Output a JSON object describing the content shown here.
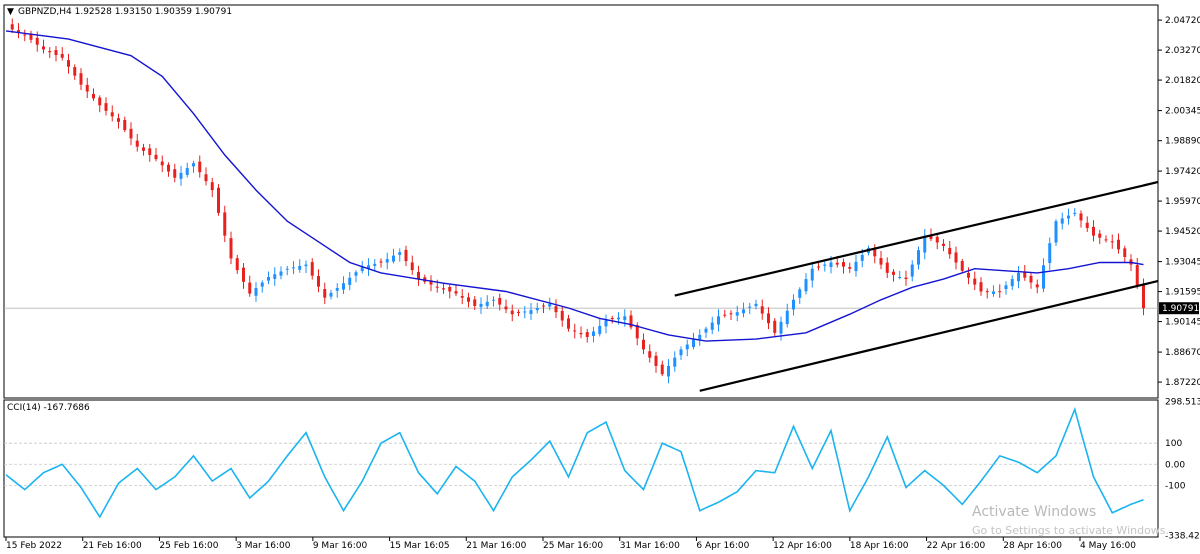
{
  "chart_data": [
    {
      "type": "candlestick",
      "title": "GBPNZD,H4",
      "ohlc_header": "1.92528 1.93150 1.90359 1.90791",
      "current_price": "1.90791",
      "ylim": [
        1.8645,
        2.0545
      ],
      "y_ticks": [
        "2.04720",
        "2.03270",
        "2.01820",
        "2.00345",
        "1.98890",
        "1.97420",
        "1.95970",
        "1.94520",
        "1.93045",
        "1.91595",
        "1.90145",
        "1.88670",
        "1.87220"
      ],
      "x_ticks": [
        "15 Feb 2022",
        "21 Feb 16:00",
        "25 Feb 16:00",
        "3 Mar 16:00",
        "9 Mar 16:00",
        "15 Mar 16:05",
        "21 Mar 16:00",
        "25 Mar 16:00",
        "31 Mar 16:00",
        "6 Apr 16:00",
        "12 Apr 16:00",
        "18 Apr 16:00",
        "22 Apr 16:00",
        "28 Apr 16:00",
        "4 May 16:00"
      ],
      "close_path": [
        [
          0,
          2.044
        ],
        [
          3,
          2.04
        ],
        [
          6,
          2.033
        ],
        [
          9,
          2.029
        ],
        [
          12,
          2.016
        ],
        [
          15,
          2.006
        ],
        [
          18,
          1.998
        ],
        [
          21,
          1.986
        ],
        [
          24,
          1.98
        ],
        [
          27,
          1.971
        ],
        [
          30,
          1.978
        ],
        [
          33,
          1.965
        ],
        [
          36,
          1.932
        ],
        [
          39,
          1.915
        ],
        [
          42,
          1.923
        ],
        [
          45,
          1.927
        ],
        [
          48,
          1.929
        ],
        [
          51,
          1.913
        ],
        [
          54,
          1.92
        ],
        [
          57,
          1.928
        ],
        [
          60,
          1.93
        ],
        [
          63,
          1.935
        ],
        [
          66,
          1.922
        ],
        [
          69,
          1.918
        ],
        [
          72,
          1.915
        ],
        [
          75,
          1.909
        ],
        [
          78,
          1.912
        ],
        [
          81,
          1.905
        ],
        [
          84,
          1.907
        ],
        [
          87,
          1.91
        ],
        [
          90,
          1.898
        ],
        [
          93,
          1.894
        ],
        [
          96,
          1.902
        ],
        [
          99,
          1.904
        ],
        [
          102,
          1.888
        ],
        [
          105,
          1.876
        ],
        [
          108,
          1.888
        ],
        [
          111,
          1.895
        ],
        [
          114,
          1.904
        ],
        [
          117,
          1.906
        ],
        [
          120,
          1.91
        ],
        [
          123,
          1.896
        ],
        [
          126,
          1.912
        ],
        [
          129,
          1.927
        ],
        [
          132,
          1.93
        ],
        [
          135,
          1.927
        ],
        [
          138,
          1.937
        ],
        [
          141,
          1.925
        ],
        [
          144,
          1.922
        ],
        [
          147,
          1.943
        ],
        [
          150,
          1.938
        ],
        [
          153,
          1.926
        ],
        [
          156,
          1.916
        ],
        [
          159,
          1.916
        ],
        [
          162,
          1.925
        ],
        [
          165,
          1.918
        ],
        [
          168,
          1.95
        ],
        [
          171,
          1.954
        ],
        [
          174,
          1.943
        ],
        [
          177,
          1.94
        ],
        [
          180,
          1.929
        ],
        [
          182,
          1.9079
        ]
      ],
      "moving_average": [
        [
          0,
          2.042
        ],
        [
          10,
          2.038
        ],
        [
          20,
          2.03
        ],
        [
          25,
          2.02
        ],
        [
          30,
          2.002
        ],
        [
          35,
          1.982
        ],
        [
          40,
          1.965
        ],
        [
          45,
          1.95
        ],
        [
          50,
          1.94
        ],
        [
          55,
          1.93
        ],
        [
          60,
          1.925
        ],
        [
          70,
          1.92
        ],
        [
          80,
          1.916
        ],
        [
          90,
          1.908
        ],
        [
          95,
          1.903
        ],
        [
          100,
          1.9
        ],
        [
          106,
          1.895
        ],
        [
          112,
          1.892
        ],
        [
          120,
          1.893
        ],
        [
          128,
          1.896
        ],
        [
          135,
          1.905
        ],
        [
          140,
          1.912
        ],
        [
          145,
          1.918
        ],
        [
          150,
          1.922
        ],
        [
          155,
          1.927
        ],
        [
          160,
          1.926
        ],
        [
          165,
          1.925
        ],
        [
          170,
          1.927
        ],
        [
          175,
          1.93
        ],
        [
          180,
          1.93
        ],
        [
          182,
          1.929
        ]
      ],
      "channel_upper": [
        [
          107,
          1.914
        ],
        [
          245,
          2.012
        ]
      ],
      "channel_lower": [
        [
          111,
          1.868
        ],
        [
          245,
          1.965
        ]
      ]
    },
    {
      "type": "line",
      "title": "CCI(14) -167.7686",
      "ylim": [
        -345,
        305
      ],
      "y_ticks": [
        "298.5137",
        "100",
        "0.00",
        "-100",
        "-338.4288"
      ],
      "levels": [
        100,
        0,
        -100
      ],
      "values": [
        [
          0,
          -50
        ],
        [
          3,
          -120
        ],
        [
          6,
          -40
        ],
        [
          9,
          0
        ],
        [
          12,
          -110
        ],
        [
          15,
          -250
        ],
        [
          18,
          -90
        ],
        [
          21,
          -20
        ],
        [
          24,
          -120
        ],
        [
          27,
          -60
        ],
        [
          30,
          40
        ],
        [
          33,
          -80
        ],
        [
          36,
          -20
        ],
        [
          39,
          -160
        ],
        [
          42,
          -80
        ],
        [
          45,
          40
        ],
        [
          48,
          150
        ],
        [
          51,
          -60
        ],
        [
          54,
          -220
        ],
        [
          57,
          -80
        ],
        [
          60,
          100
        ],
        [
          63,
          150
        ],
        [
          66,
          -40
        ],
        [
          69,
          -140
        ],
        [
          72,
          -10
        ],
        [
          75,
          -80
        ],
        [
          78,
          -220
        ],
        [
          81,
          -60
        ],
        [
          84,
          20
        ],
        [
          87,
          110
        ],
        [
          90,
          -60
        ],
        [
          93,
          150
        ],
        [
          96,
          200
        ],
        [
          99,
          -30
        ],
        [
          102,
          -120
        ],
        [
          105,
          100
        ],
        [
          108,
          60
        ],
        [
          111,
          -220
        ],
        [
          114,
          -180
        ],
        [
          117,
          -130
        ],
        [
          120,
          -30
        ],
        [
          123,
          -40
        ],
        [
          126,
          180
        ],
        [
          129,
          -20
        ],
        [
          132,
          160
        ],
        [
          135,
          -220
        ],
        [
          138,
          -60
        ],
        [
          141,
          130
        ],
        [
          144,
          -110
        ],
        [
          147,
          -30
        ],
        [
          150,
          -100
        ],
        [
          153,
          -190
        ],
        [
          156,
          -80
        ],
        [
          159,
          40
        ],
        [
          162,
          10
        ],
        [
          165,
          -40
        ],
        [
          168,
          40
        ],
        [
          171,
          260
        ],
        [
          174,
          -60
        ],
        [
          177,
          -230
        ],
        [
          180,
          -190
        ],
        [
          182,
          -168
        ]
      ]
    }
  ],
  "watermark": {
    "line1": "Activate Windows",
    "line2": "Go to Settings to activate Windows."
  }
}
